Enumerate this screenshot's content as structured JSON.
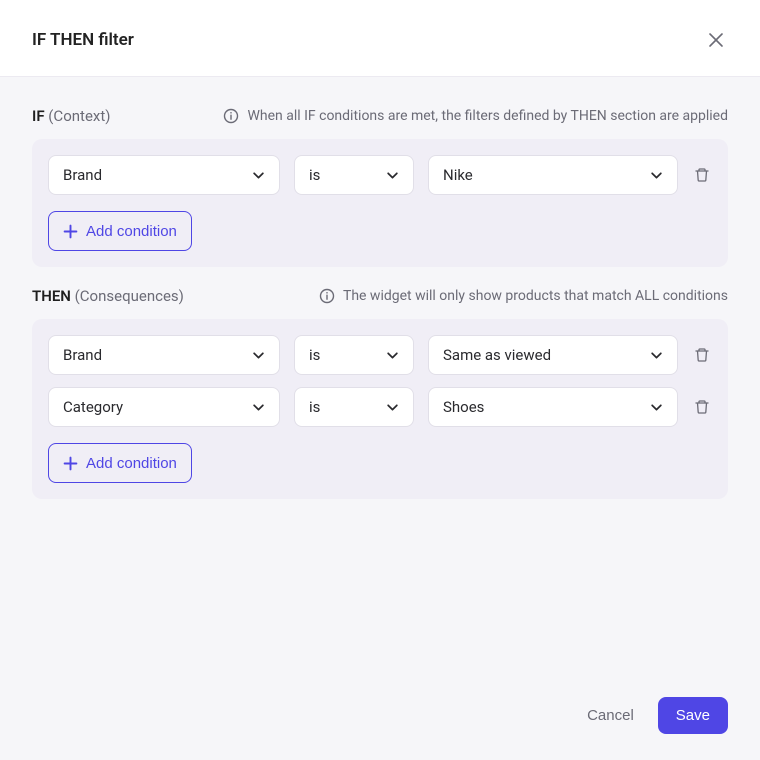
{
  "header": {
    "title": "IF THEN filter"
  },
  "if": {
    "label": "IF",
    "sublabel": "(Context)",
    "hint": "When all IF conditions are met, the filters defined by THEN section are applied",
    "conditions": [
      {
        "attribute": "Brand",
        "operator": "is",
        "value": "Nike"
      }
    ],
    "add_label": "Add condition"
  },
  "then": {
    "label": "THEN",
    "sublabel": "(Consequences)",
    "hint": "The widget will only show products that match ALL conditions",
    "conditions": [
      {
        "attribute": "Brand",
        "operator": "is",
        "value": "Same as viewed"
      },
      {
        "attribute": "Category",
        "operator": "is",
        "value": "Shoes"
      }
    ],
    "add_label": "Add condition"
  },
  "footer": {
    "cancel": "Cancel",
    "save": "Save"
  },
  "colors": {
    "accent": "#4f46e5"
  }
}
